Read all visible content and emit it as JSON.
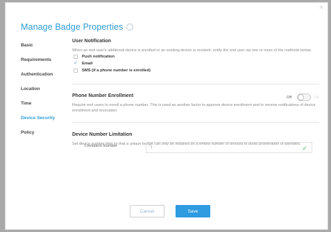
{
  "dialog": {
    "title": "Manage Badge Properties",
    "close_glyph": "×",
    "nav": [
      {
        "label": "Basic",
        "active": false
      },
      {
        "label": "Requirements",
        "active": false
      },
      {
        "label": "Authentication",
        "active": false
      },
      {
        "label": "Location",
        "active": false
      },
      {
        "label": "Time",
        "active": false
      },
      {
        "label": "Device Security",
        "active": true
      },
      {
        "label": "Policy",
        "active": false
      }
    ]
  },
  "user_notification": {
    "title": "User Notification",
    "description": "When an end user's additional device is enrolled or an existing device is revoked, notify the end user via one or more of the methods below.",
    "options": [
      {
        "label": "Push notification",
        "checked": false
      },
      {
        "label": "Email",
        "checked": true
      },
      {
        "label": "SMS (if a phone number is enrolled)",
        "checked": false
      }
    ]
  },
  "phone_enrollment": {
    "title": "Phone Number Enrollment",
    "description": "Require end users to enroll a phone number. This is used as another factor to approve device enrollment and to receive notifications of device enrollment and revocation.",
    "toggle_off_label": "Off",
    "toggle_on_label": "On",
    "enabled": false
  },
  "device_limit": {
    "title": "Device Number Limitation",
    "description": "Set device number limit so that a unique badge can only be installed on a limited number of devices to avoid proliferation of identities.",
    "field_label": "Limitation Number",
    "field_value": "1"
  },
  "buttons": {
    "cancel": "Cancel",
    "save": "Save"
  },
  "colors": {
    "accent": "#2c9bd6",
    "save_button": "#2f9be0",
    "valid_check": "#3fb354"
  }
}
